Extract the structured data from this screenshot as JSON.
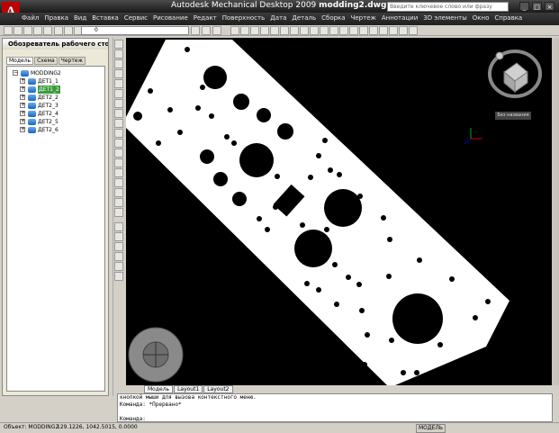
{
  "window": {
    "app_title": "Autodesk Mechanical Desktop 2009",
    "file_name": "modding2.dwg",
    "search_placeholder": "Введите ключевое слово или фразу"
  },
  "menu": [
    "Файл",
    "Правка",
    "Вид",
    "Вставка",
    "Сервис",
    "Рисование",
    "Редакт",
    "Поверхность",
    "Дата",
    "Деталь",
    "Сборка",
    "Чертеж",
    "Аннотации",
    "3D элементы",
    "Окно",
    "Справка"
  ],
  "toolbar": {
    "layer_value": "0"
  },
  "palette": {
    "title": "Обозреватель рабочего стола",
    "tabs": [
      "Модель",
      "Схема",
      "Чертеж"
    ],
    "root": "MODDING2",
    "items": [
      {
        "label": "ДЕТ1_1",
        "selected": false
      },
      {
        "label": "ДЕТ1_2",
        "selected": true
      },
      {
        "label": "ДЕТ2_2",
        "selected": false
      },
      {
        "label": "ДЕТ2_3",
        "selected": false
      },
      {
        "label": "ДЕТ2_4",
        "selected": false
      },
      {
        "label": "ДЕТ2_5",
        "selected": false
      },
      {
        "label": "ДЕТ2_6",
        "selected": false
      }
    ]
  },
  "viewcube": {
    "label": "Без названия"
  },
  "layout_tabs": [
    "Модель",
    "Layout1",
    "Layout2"
  ],
  "command": {
    "lines": [
      "кнопкой мыши для вызова контекстного меню.",
      "Команда: *Прервано*",
      "",
      "Команда:"
    ]
  },
  "status": {
    "object": "Объект: MODDING2",
    "coords": "129.1226, 1042.5015, 0.0000",
    "model": "МОДЕЛЬ"
  },
  "colors": {
    "drawing_bg": "#000000",
    "part": "#ffffff",
    "accent": "#b00000",
    "selection": "#3a9a3a"
  }
}
